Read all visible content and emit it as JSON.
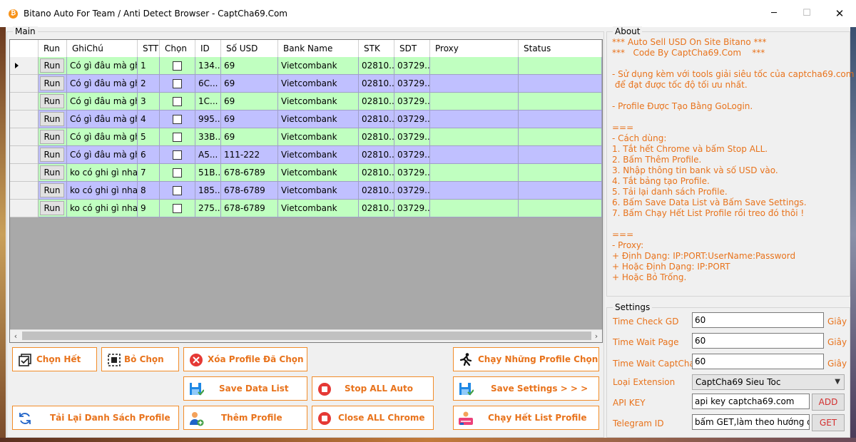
{
  "window": {
    "title": "Bitano Auto For Team / Anti Detect Browser - CaptCha69.Com",
    "app_icon": "bitcoin-icon",
    "minimize": "─",
    "maximize": "☐",
    "close": "✕"
  },
  "main_group": {
    "label": "Main"
  },
  "grid": {
    "columns": [
      "Run",
      "GhiChú",
      "STT",
      "Chọn",
      "ID",
      "Số USD",
      "Bank Name",
      "STK",
      "SDT",
      "Proxy",
      "Status"
    ],
    "run_label": "Run",
    "rows": [
      {
        "note": "Có gì đâu mà ghi",
        "stt": "1",
        "id": "134...",
        "usd": "69",
        "bank": "Vietcombank",
        "stk": "02810...",
        "sdt": "03729...",
        "proxy": "",
        "status": "",
        "color": "#c0ffc0",
        "current": true
      },
      {
        "note": "Có gì đâu mà ghi",
        "stt": "2",
        "id": "6C...",
        "usd": "69",
        "bank": "Vietcombank",
        "stk": "02810...",
        "sdt": "03729...",
        "proxy": "",
        "status": "",
        "color": "#c0c0ff",
        "current": false
      },
      {
        "note": "Có gì đâu mà ghi",
        "stt": "3",
        "id": "1C...",
        "usd": "69",
        "bank": "Vietcombank",
        "stk": "02810...",
        "sdt": "03729...",
        "proxy": "",
        "status": "",
        "color": "#c0ffc0",
        "current": false
      },
      {
        "note": "Có gì đâu mà ghi",
        "stt": "4",
        "id": "995...",
        "usd": "69",
        "bank": "Vietcombank",
        "stk": "02810...",
        "sdt": "03729...",
        "proxy": "",
        "status": "",
        "color": "#c0c0ff",
        "current": false
      },
      {
        "note": "Có gì đâu mà ghi",
        "stt": "5",
        "id": "33B...",
        "usd": "69",
        "bank": "Vietcombank",
        "stk": "02810...",
        "sdt": "03729...",
        "proxy": "",
        "status": "",
        "color": "#c0ffc0",
        "current": false
      },
      {
        "note": "Có gì đâu mà ghi",
        "stt": "6",
        "id": "A5...",
        "usd": "111-222",
        "bank": "Vietcombank",
        "stk": "02810...",
        "sdt": "03729...",
        "proxy": "",
        "status": "",
        "color": "#c0c0ff",
        "current": false
      },
      {
        "note": "ko có ghi gì nha",
        "stt": "7",
        "id": "51B...",
        "usd": "678-6789",
        "bank": "Vietcombank",
        "stk": "02810...",
        "sdt": "03729...",
        "proxy": "",
        "status": "",
        "color": "#c0ffc0",
        "current": false
      },
      {
        "note": "ko có ghi gì nha",
        "stt": "8",
        "id": "185...",
        "usd": "678-6789",
        "bank": "Vietcombank",
        "stk": "02810...",
        "sdt": "03729...",
        "proxy": "",
        "status": "",
        "color": "#c0c0ff",
        "current": false
      },
      {
        "note": "ko có ghi gì nha",
        "stt": "9",
        "id": "275...",
        "usd": "678-6789",
        "bank": "Vietcombank",
        "stk": "02810...",
        "sdt": "03729...",
        "proxy": "",
        "status": "",
        "color": "#c0ffc0",
        "current": false
      }
    ]
  },
  "actions": {
    "select_all": "Chọn Hết",
    "deselect": "Bỏ Chọn",
    "delete_selected": "Xóa Profile Đã Chọn",
    "run_selected": "Chạy Những Profile Chọn",
    "save_data": "Save Data List",
    "stop_all": "Stop ALL Auto",
    "save_settings": "Save Settings > > >",
    "reload_list": "Tải Lại Danh Sách Profile",
    "add_profile": "Thêm Profile",
    "close_chrome": "Close ALL Chrome",
    "run_all": "Chạy Hết List Profile"
  },
  "about": {
    "label": "About",
    "text": "*** Auto Sell USD On Site Bitano ***\n***   Code By CaptCha69.Com    ***\n\n- Sử dụng kèm với tools giải siêu tốc của captcha69.com\n để đạt được tốc độ tối ưu nhất.\n\n- Profile Được Tạo Bằng GoLogin.\n\n===\n- Cách dùng:\n1. Tắt hết Chrome và bấm Stop ALL.\n2. Bấm Thêm Profile.\n3. Nhập thông tin bank và số USD vào.\n4. Tắt bảng tạo Profile.\n5. Tải lại danh sách Profile.\n6. Bấm Save Data List và Bấm Save Settings.\n7. Bấm Chạy Hết List Profile rồi treo đó thôi !\n\n===\n- Proxy:\n+ Định Dạng: IP:PORT:UserName:Password\n+ Hoặc Định Dạng: IP:PORT\n+ Hoặc Bỏ Trống."
  },
  "settings": {
    "label": "Settings",
    "time_check_label": "Time Check GD",
    "time_check_value": "60",
    "time_wait_page_label": "Time Wait Page",
    "time_wait_page_value": "60",
    "time_wait_captcha_label": "Time Wait CaptCha",
    "time_wait_captcha_value": "60",
    "unit": "Giây",
    "extension_label": "Loại Extension",
    "extension_value": "CaptCha69 Sieu Toc",
    "api_key_label": "API KEY",
    "api_key_value": "api key captcha69.com",
    "add_button": "ADD",
    "telegram_label": "Telegram ID",
    "telegram_value": "bấm GET,làm theo hướng dẫn",
    "get_button": "GET"
  },
  "colors": {
    "accent": "#e8731c",
    "row_green": "#c0ffc0",
    "row_blue": "#c0c0ff",
    "grid_bg": "#a9a9a9"
  }
}
